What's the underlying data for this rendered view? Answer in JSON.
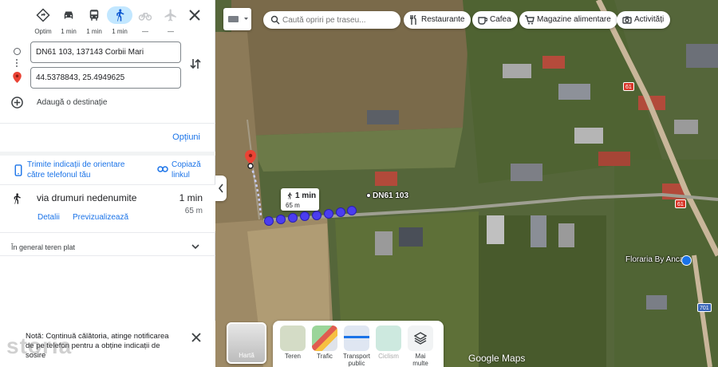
{
  "travel_modes": [
    {
      "name": "directions-icon",
      "label": "Optim"
    },
    {
      "name": "car-icon",
      "label": "1 min"
    },
    {
      "name": "transit-icon",
      "label": "1 min"
    },
    {
      "name": "walk-icon",
      "label": "1 min"
    },
    {
      "name": "bike-icon",
      "label": "—"
    },
    {
      "name": "plane-icon",
      "label": "—"
    }
  ],
  "origin": {
    "value": "DN61 103, 137143 Corbii Mari"
  },
  "destination": {
    "value": "44.5378843, 25.4949625"
  },
  "add_destination_label": "Adaugă o destinație",
  "options_label": "Opțiuni",
  "send_to_phone": {
    "line1": "Trimite indicații de orientare",
    "line2": "către telefonul tău"
  },
  "copy_link": {
    "line1": "Copiază",
    "line2": "linkul"
  },
  "route": {
    "name": "via drumuri nedenumite",
    "time": "1 min",
    "distance": "65 m",
    "details_label": "Detalii",
    "preview_label": "Previzualizează"
  },
  "terrain_note": "În general teren plat",
  "notification": {
    "text": "Notă: Continuă călătoria, atinge notificarea de pe telefon pentru a obține indicații de sosire"
  },
  "watermark": "storia",
  "map": {
    "search_placeholder": "Caută opriri pe traseu...",
    "chips": [
      "Restaurante",
      "Cafea",
      "Magazine alimentare",
      "Activități"
    ],
    "callout_time": "1 min",
    "callout_distance": "65 m",
    "destination_label": "DN61 103",
    "place_label": "Floraria By Anca",
    "road_badges": [
      "61",
      "61",
      "701"
    ],
    "layer_main": "Hartă",
    "layers": [
      "Teren",
      "Trafic",
      "Transport public",
      "Ciclism",
      "Mai multe"
    ],
    "brand": "Google Maps",
    "colors": {
      "route": "#4b3df0",
      "accent": "#1a73e8",
      "pin": "#ea4335"
    }
  }
}
